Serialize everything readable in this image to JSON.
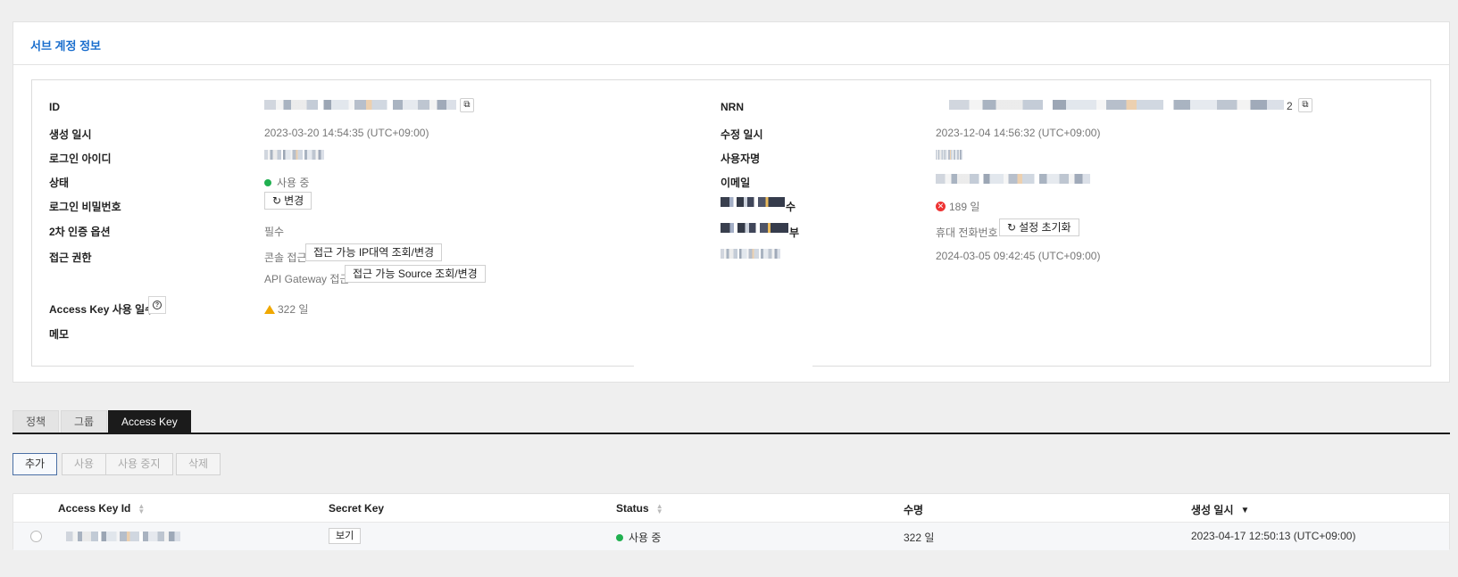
{
  "panel": {
    "title": "서브 계정 정보"
  },
  "left_fields": {
    "id_label": "ID",
    "created_label": "생성 일시",
    "created_value": "2023-03-20 14:54:35 (UTC+09:00)",
    "login_id_label": "로그인 아이디",
    "status_label": "상태",
    "status_value": "사용 중",
    "password_label": "로그인 비밀번호",
    "password_button": "변경",
    "mfa_label": "2차 인증 옵션",
    "mfa_value": "필수",
    "access_label": "접근 권한",
    "console_access_label": "콘솔 접근",
    "console_access_button": "접근 가능 IP대역 조회/변경",
    "apigw_access_label": "API Gateway 접근",
    "apigw_access_button": "접근 가능 Source 조회/변경",
    "access_key_days_label": "Access Key 사용 일수",
    "access_key_days_value": "322 일",
    "memo_label": "메모"
  },
  "right_fields": {
    "nrn_label": "NRN",
    "nrn_suffix": "2",
    "modified_label": "수정 일시",
    "modified_value": "2023-12-04 14:56:32 (UTC+09:00)",
    "username_label": "사용자명",
    "email_label": "이메일",
    "label_4_suffix": "수",
    "value_4": "189 일",
    "label_5_suffix": "부",
    "phone_label": "휴대 전화번호",
    "reset_button": "설정 초기화",
    "value_6": "2024-03-05 09:42:45 (UTC+09:00)"
  },
  "tabs": [
    "정책",
    "그룹",
    "Access Key"
  ],
  "actions": {
    "add": "추가",
    "enable": "사용",
    "disable": "사용 중지",
    "delete": "삭제"
  },
  "table": {
    "columns": [
      "Access Key Id",
      "Secret Key",
      "Status",
      "수명",
      "생성 일시"
    ],
    "rows": [
      {
        "secret_button": "보기",
        "status": "사용 중",
        "lifetime": "322 일",
        "created": "2023-04-17 12:50:13 (UTC+09:00)"
      }
    ]
  },
  "colors": {
    "accent": "#1a6ecd",
    "active_tab": "#1b1b1b",
    "status_green": "#20b050",
    "error_red": "#ee3333",
    "warning": "#f0a800"
  },
  "icons": [
    "copy-icon",
    "refresh-icon",
    "help-icon",
    "warning-icon",
    "error-icon",
    "sort-icon"
  ]
}
